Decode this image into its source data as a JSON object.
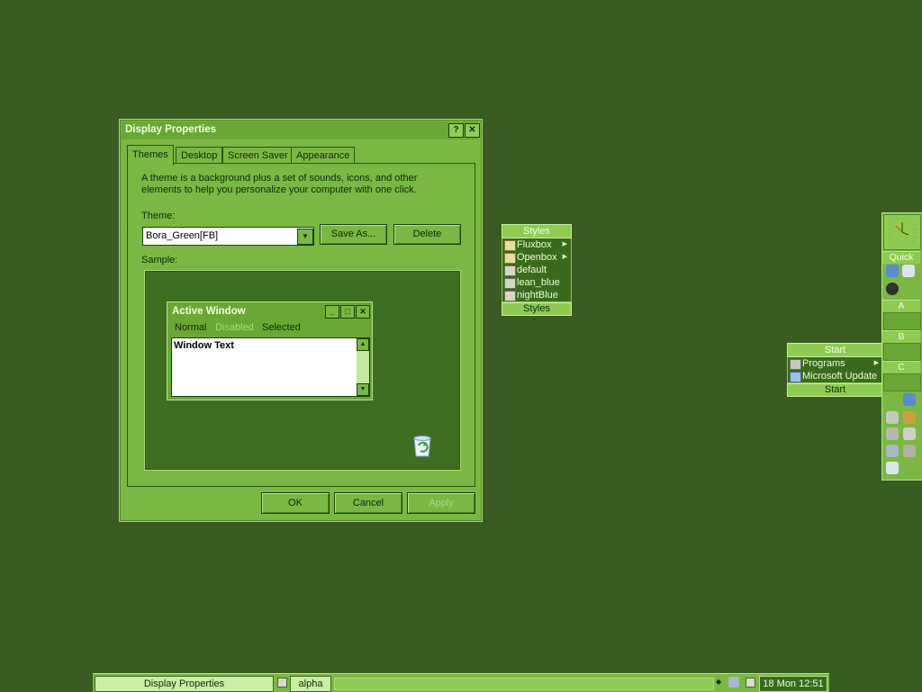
{
  "colors": {
    "desktop": "#3a5b22",
    "window": "#7ab843",
    "titlebar": "#6aa835",
    "menu_title": "#8ecb52",
    "menu_body": "#3a6a1e"
  },
  "display_properties": {
    "title": "Display Properties",
    "help_btn": "?",
    "close_btn": "✕",
    "tabs": [
      {
        "label": "Themes"
      },
      {
        "label": "Desktop"
      },
      {
        "label": "Screen Saver"
      },
      {
        "label": "Appearance"
      }
    ],
    "description": "A theme is a background plus a set of sounds, icons, and other elements to help you personalize your computer with one click.",
    "theme_label": "Theme:",
    "theme_value": "Bora_Green[FB]",
    "save_as": "Save As...",
    "delete": "Delete",
    "sample_label": "Sample:",
    "sample_window": {
      "title": "Active Window",
      "menu": [
        "Normal",
        "Disabled",
        "Selected"
      ],
      "window_text": "Window Text"
    },
    "ok": "OK",
    "cancel": "Cancel",
    "apply": "Apply"
  },
  "styles_menu": {
    "title": "Styles",
    "items": [
      {
        "label": "Fluxbox",
        "icon": "folder-icon",
        "submenu": true
      },
      {
        "label": "Openbox",
        "icon": "folder-icon",
        "submenu": true
      },
      {
        "label": "default",
        "icon": "style-file-icon",
        "submenu": false
      },
      {
        "label": "lean_blue",
        "icon": "style-file-icon",
        "submenu": false
      },
      {
        "label": "nightBlue",
        "icon": "style-file-icon",
        "submenu": false
      }
    ],
    "footer": "Styles"
  },
  "start_menu": {
    "title": "Start",
    "items": [
      {
        "label": "Programs",
        "icon": "programs-icon",
        "submenu": true
      },
      {
        "label": "Microsoft Update",
        "icon": "update-icon",
        "submenu": false
      }
    ],
    "footer": "Start"
  },
  "slit": {
    "quick": "Quick",
    "a": "A",
    "b": "B",
    "c": "C"
  },
  "taskbar": {
    "task_active": "Display Properties",
    "workspace": "alpha",
    "clock": "18 Mon 12:51"
  }
}
